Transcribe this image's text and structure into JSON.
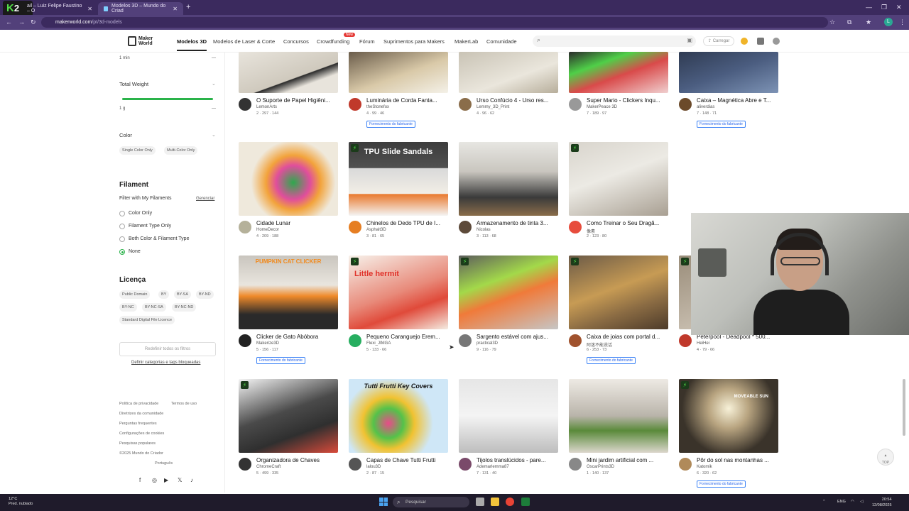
{
  "browser": {
    "tabs": [
      {
        "label": "ail – Luiz Felipe Faustino – O"
      },
      {
        "label": "Modelos 3D – Mundo do Criad"
      }
    ],
    "url_host": "makerworld.com",
    "url_path": "/pt/3d-models",
    "profile_initial": "L"
  },
  "site": {
    "logo_line1": "Maker",
    "logo_line2": "World",
    "nav": [
      {
        "label": "Modelos 3D"
      },
      {
        "label": "Modelos de Laser & Corte"
      },
      {
        "label": "Concursos"
      },
      {
        "label": "Crowdfunding"
      },
      {
        "label": "Fórum"
      },
      {
        "label": "Suprimentos para Makers"
      },
      {
        "label": "MakerLab"
      },
      {
        "label": "Comunidade"
      }
    ],
    "new_badge": "New",
    "upload_label": "Carregar"
  },
  "sidebar": {
    "time_value": "1 min",
    "total_weight_label": "Total Weight",
    "weight_value": "1 g",
    "color_label": "Color",
    "color_chips": [
      "Single Color Only",
      "Multi-Color Only"
    ],
    "filament_heading": "Filament",
    "filter_label": "Filter with My Filaments",
    "manage_label": "Gerenciar",
    "filament_options": [
      {
        "label": "Color Only"
      },
      {
        "label": "Filament Type Only"
      },
      {
        "label": "Both Color & Filament Type"
      },
      {
        "label": "None"
      }
    ],
    "license_heading": "Licença",
    "license_chips": [
      "Public Domain",
      "BY",
      "BY-SA",
      "BY-ND",
      "BY-NC",
      "BY-NC-SA",
      "BY-NC-ND",
      "Standard Digital File Licence"
    ],
    "reset_label": "Redefinir todos os filtros",
    "blocked_link": "Definir categorias e tags bloqueadas",
    "footer_links": [
      "Política de privacidade",
      "Termos de uso",
      "Diretrizes da comunidade",
      "Perguntas frequentes",
      "Configurações de cookies",
      "Pesquisas populares",
      "©2025 Mundo do Criador"
    ],
    "language": "Português"
  },
  "maker_tag_label": "Fornecimento do fabricante",
  "grid": [
    {
      "title": "O Suporte de Papel Higiêni...",
      "author": "LemonArts",
      "stats": "2 · 297 · 144",
      "maker": false
    },
    {
      "title": "Luminária de Corda Fanta...",
      "author": "theStonefox",
      "stats": "4 · 99 · 46",
      "maker": true
    },
    {
      "title": "Urso Confúcio 4 - Urso res...",
      "author": "Lemmy_3D_Print",
      "stats": "4 · 96 · 62",
      "maker": false
    },
    {
      "title": "Super Mario - Clickers Inqu...",
      "author": "MakerPeace 3D",
      "stats": "7 · 189 · 97",
      "maker": false
    },
    {
      "title": "Caixa – Magnética Abre e T...",
      "author": "aliverdias",
      "stats": "7 · 148 · 71",
      "maker": true
    },
    {
      "title": "Cidade Lunar",
      "author": "HomeDecor",
      "stats": "4 · 209 · 188",
      "maker": false
    },
    {
      "title": "Chinelos de Dedo TPU de I...",
      "author": "Asphalt3D",
      "stats": "3 · 81 · 65",
      "maker": false,
      "overlay": "TPU Slide Sandals"
    },
    {
      "title": "Armazenamento de tinta 3...",
      "author": "Nicolas",
      "stats": "3 · 113 · 68",
      "maker": false
    },
    {
      "title": "Como Treinar o Seu Dragã...",
      "author": "像素",
      "stats": "2 · 123 · 80",
      "maker": false
    },
    {
      "title": "",
      "author": "",
      "stats": "",
      "maker": false
    },
    {
      "title": "Clicker de Gato Abóbora",
      "author": "Makerize3D",
      "stats": "5 · 156 · 117",
      "maker": true,
      "overlay": "PUMPKIN CAT CLICKER"
    },
    {
      "title": "Pequeno Caranguejo Erem...",
      "author": "Flexi_JIMGA",
      "stats": "5 · 133 · 66",
      "maker": false,
      "overlay": "Little hermit"
    },
    {
      "title": "Sargento estável com ajus...",
      "author": "practical3D",
      "stats": "9 · 116 · 79",
      "maker": false
    },
    {
      "title": "Caixa de joias com portal d...",
      "author": "阿迷不能说话",
      "stats": "6 · 253 · 73",
      "maker": true
    },
    {
      "title": "Peterpool - Deadpool * 500...",
      "author": "HeiHei",
      "stats": "4 · 79 · 66",
      "maker": false
    },
    {
      "title": "Organizadora de Chaves",
      "author": "ChromeCraft",
      "stats": "5 · 499 · 335",
      "maker": false
    },
    {
      "title": "Capas de Chave Tutti Frutti",
      "author": "lalou3D",
      "stats": "2 · 87 · 15",
      "maker": false,
      "overlay": "Tutti Frutti Key Covers"
    },
    {
      "title": "Tijolos translúcidos - pare...",
      "author": "Ademarlemma87",
      "stats": "7 · 131 · 40",
      "maker": false
    },
    {
      "title": "Mini jardim artificial com ...",
      "author": "OscarPrints3D",
      "stats": "1 · 140 · 137",
      "maker": false
    },
    {
      "title": "Pôr do sol nas montanhas ...",
      "author": "Katomik",
      "stats": "6 · 320 · 62",
      "maker": true,
      "overlay": "MOVEABLE SUN"
    }
  ],
  "scroll_top_label": "TOP",
  "taskbar": {
    "weather_temp": "12°C",
    "weather_desc": "Pred. nublado",
    "search_placeholder": "Pesquisar",
    "lang": "ENG",
    "time": "20:54",
    "date": "12/08/2025"
  },
  "colors": {
    "accent_green": "#2ab34a",
    "maker_blue": "#2563eb",
    "chrome_purple": "#52407a"
  }
}
